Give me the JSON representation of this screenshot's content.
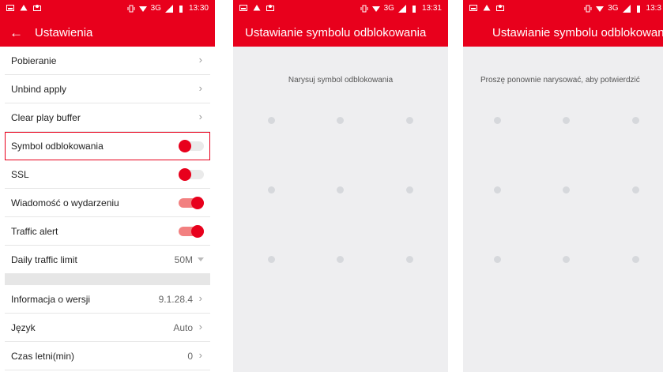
{
  "status_bar": {
    "panel1": {
      "network": "3G",
      "time": "13:30"
    },
    "panel2": {
      "network": "3G",
      "time": "13:31"
    },
    "panel3": {
      "network": "3G",
      "time": "13:3"
    }
  },
  "settings": {
    "back_icon": "back-arrow",
    "title": "Ustawienia",
    "rows": [
      {
        "label": "Pobieranie",
        "control": "chevron"
      },
      {
        "label": "Unbind apply",
        "control": "chevron"
      },
      {
        "label": "Clear play buffer",
        "control": "chevron"
      },
      {
        "label": "Symbol odblokowania",
        "control": "toggle",
        "state": "off",
        "highlighted": true
      },
      {
        "label": "SSL",
        "control": "toggle",
        "state": "off"
      },
      {
        "label": "Wiadomość o wydarzeniu",
        "control": "toggle",
        "state": "on"
      },
      {
        "label": "Traffic alert",
        "control": "toggle",
        "state": "on"
      },
      {
        "label": "Daily traffic limit",
        "control": "dropdown",
        "value": "50M"
      }
    ],
    "rows_after_gap": [
      {
        "label": "Informacja o wersji",
        "value": "9.1.28.4"
      },
      {
        "label": "Język",
        "value": "Auto"
      },
      {
        "label": "Czas letni(min)",
        "value": "0"
      }
    ],
    "chevron_glyph": "›"
  },
  "unlock_draw": {
    "title": "Ustawianie symbolu odblokowania",
    "prompt": "Narysuj symbol odblokowania",
    "grid": "3x3"
  },
  "unlock_confirm": {
    "title": "Ustawianie symbolu odblokowani",
    "prompt": "Proszę ponownie narysować, aby potwierdzić",
    "grid": "3x3"
  },
  "colors": {
    "accent": "#e8001c",
    "pattern_bg": "#eeeef0",
    "dot": "#d6d8dc"
  }
}
